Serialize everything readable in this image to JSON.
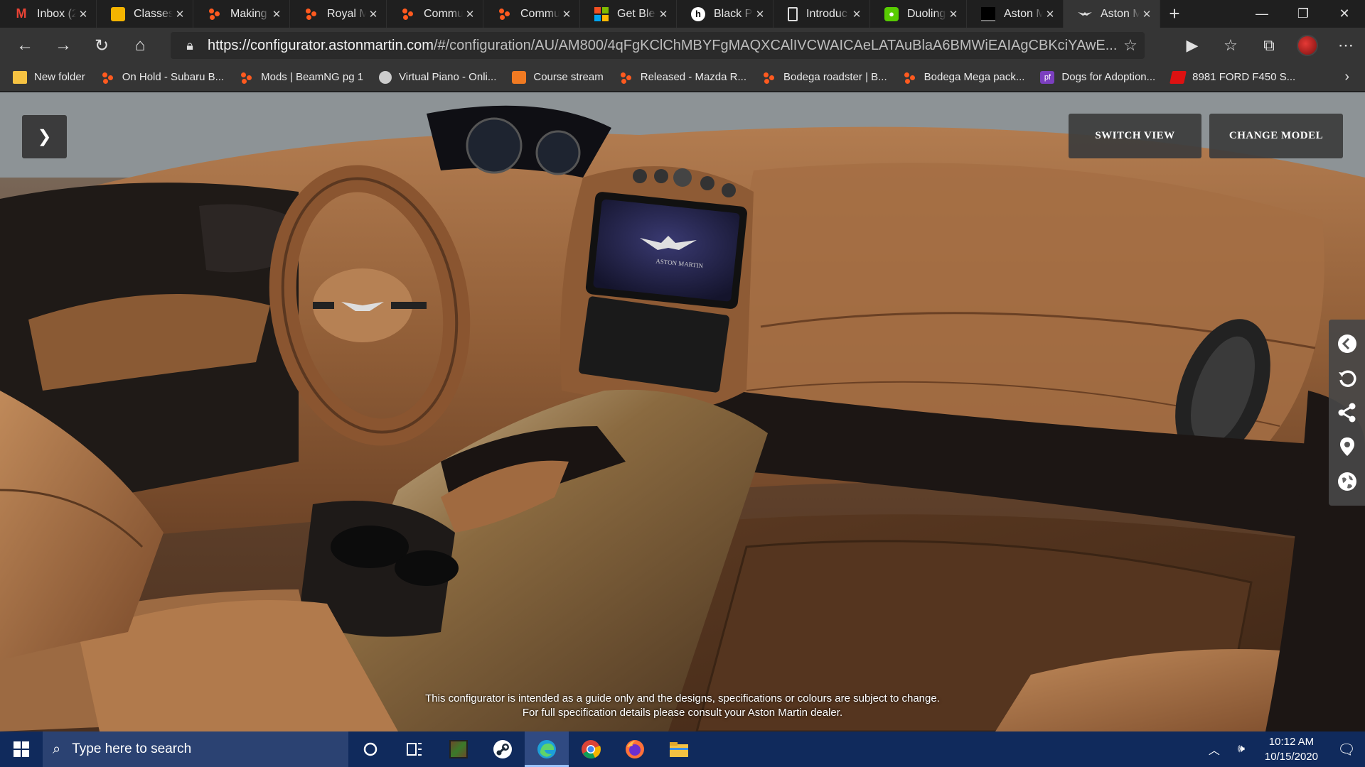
{
  "browser": {
    "tabs": [
      {
        "title": "Inbox (2",
        "icon": "gmail-icon",
        "active": false
      },
      {
        "title": "Classes",
        "icon": "google-classroom-icon",
        "active": false
      },
      {
        "title": "Making",
        "icon": "orange-dots-icon",
        "active": false
      },
      {
        "title": "Royal M",
        "icon": "orange-dots-icon",
        "active": false
      },
      {
        "title": "Commu",
        "icon": "orange-dots-icon",
        "active": false
      },
      {
        "title": "Commu",
        "icon": "orange-dots-icon",
        "active": false
      },
      {
        "title": "Get Blen",
        "icon": "microsoft-icon",
        "active": false
      },
      {
        "title": "Black Pa",
        "icon": "h-icon",
        "active": false
      },
      {
        "title": "Introduc",
        "icon": "document-icon",
        "active": false
      },
      {
        "title": "Duoling",
        "icon": "duolingo-icon",
        "active": false
      },
      {
        "title": "Aston M",
        "icon": "aston-martin-icon",
        "active": false
      },
      {
        "title": "Aston M",
        "icon": "aston-martin-icon",
        "active": true
      }
    ],
    "address": {
      "domain": "https://configurator.astonmartin.com",
      "path": "/#/configuration/AU/AM800/4qFgKClChMBYFgMAQXCAlIVCWAICAeLATAuBlaA6BMWiEAIAgCBKciYAwE..."
    },
    "bookmarks": [
      {
        "label": "New folder",
        "icon": "folder-icon"
      },
      {
        "label": "On Hold - Subaru B...",
        "icon": "orange-dots-icon"
      },
      {
        "label": "Mods | BeamNG pg 1",
        "icon": "orange-dots-icon"
      },
      {
        "label": "Virtual Piano - Onli...",
        "icon": "piano-icon"
      },
      {
        "label": "Course stream",
        "icon": "classroom-icon"
      },
      {
        "label": "Released - Mazda R...",
        "icon": "orange-dots-icon"
      },
      {
        "label": "Bodega roadster | B...",
        "icon": "orange-dots-icon"
      },
      {
        "label": "Bodega Mega pack...",
        "icon": "orange-dots-icon"
      },
      {
        "label": "Dogs for Adoption...",
        "icon": "petfinder-icon"
      },
      {
        "label": "8981 FORD F450 S...",
        "icon": "ford-icon"
      }
    ]
  },
  "configurator": {
    "switch_view": "SWITCH VIEW",
    "change_model": "CHANGE MODEL",
    "disclaimer_line1": "This configurator is intended as a guide only and the designs, specifications or colours are subject to change.",
    "disclaimer_line2": "For full specification details please consult your Aston Martin dealer.",
    "screen_brand": "ASTON MARTIN",
    "colors": {
      "leather": "#8a5a36",
      "leather_light": "#b07a4c",
      "dark": "#1a1614"
    }
  },
  "taskbar": {
    "search_placeholder": "Type here to search",
    "time": "10:12 AM",
    "date": "10/15/2020"
  }
}
